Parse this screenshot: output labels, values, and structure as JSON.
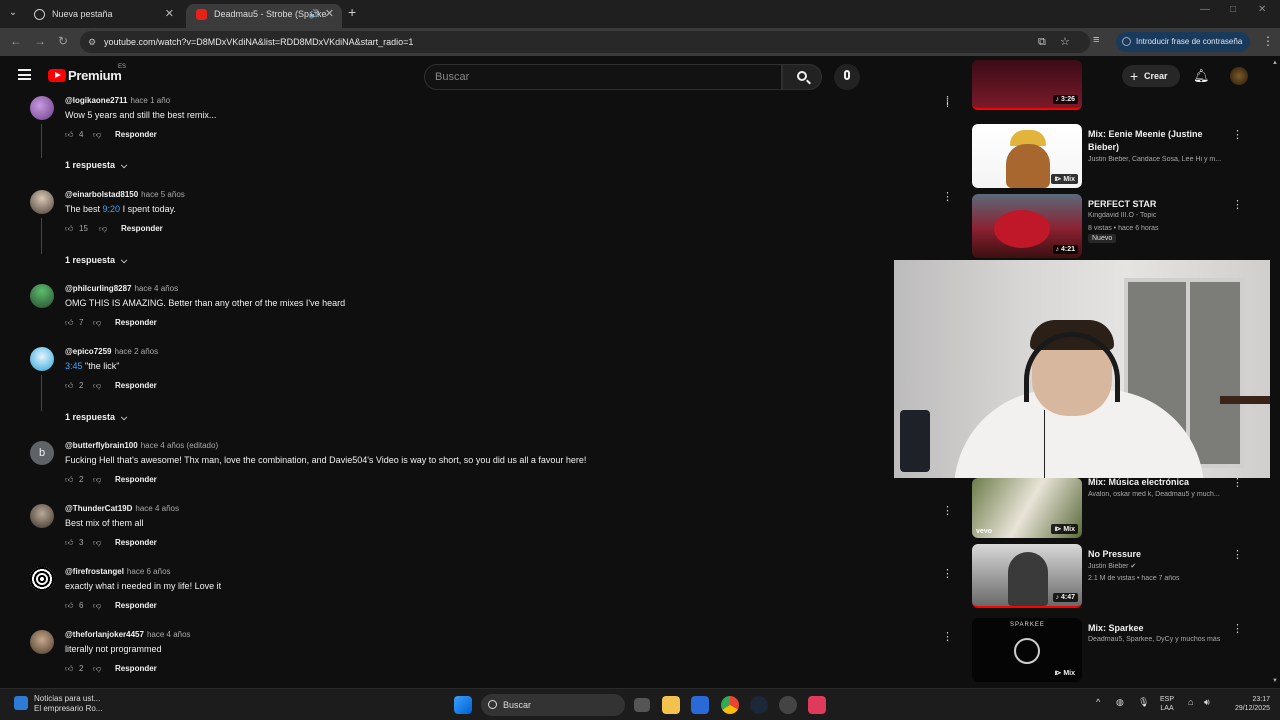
{
  "browser": {
    "tabs": [
      {
        "label": "Nueva pestaña"
      },
      {
        "label": "Deadmau5 - Strobe (Sparke"
      }
    ],
    "url": "youtube.com/watch?v=D8MDxVKdiNA&list=RDD8MDxVKdiNA&start_radio=1",
    "password_prompt": "Introducir frase de contraseña"
  },
  "header": {
    "logo_text": "Premium",
    "region": "ES",
    "search_placeholder": "Buscar",
    "create_label": "Crear"
  },
  "comments": [
    {
      "handle": "@logikaone2711",
      "time": "hace 1 año",
      "text": "Wow 5 years and still the best remix...",
      "likes": "4",
      "reply": "Responder",
      "replies": "1 respuesta"
    },
    {
      "handle": "@einarbolstad8150",
      "time": "hace 5 años",
      "text_pre": "The best ",
      "timestamp": "9:20",
      "text_post": " I spent today.",
      "likes": "15",
      "reply": "Responder",
      "replies": "1 respuesta"
    },
    {
      "handle": "@philcurling8287",
      "time": "hace 4 años",
      "text": "OMG THIS IS AMAZING. Better than any other of the mixes I've heard",
      "likes": "7",
      "reply": "Responder"
    },
    {
      "handle": "@epico7259",
      "time": "hace 2 años",
      "timestamp": "3:45",
      "text_post": " \"the lick\"",
      "likes": "2",
      "reply": "Responder",
      "replies": "1 respuesta"
    },
    {
      "handle": "@butterflybrain100",
      "time": "hace 4 años (editado)",
      "avatar_letter": "b",
      "text": "Fucking Hell that's awesome! Thx man, love the combination, and Davie504's Video is way to short, so you did us all a favour here!",
      "likes": "2",
      "reply": "Responder"
    },
    {
      "handle": "@ThunderCat19D",
      "time": "hace 4 años",
      "text": "Best mix of them all",
      "likes": "3",
      "reply": "Responder"
    },
    {
      "handle": "@firefrostangel",
      "time": "hace 6 años",
      "text": "exactly what i needed in my life! Love it",
      "likes": "6",
      "reply": "Responder"
    },
    {
      "handle": "@theforlanjoker4457",
      "time": "hace 4 años",
      "text": "literally not programmed",
      "likes": "2",
      "reply": "Responder"
    }
  ],
  "related": [
    {
      "duration": "3:26"
    },
    {
      "title": "Mix: Eenie Meenie (Justine Bieber)",
      "meta": "Justin Bieber, Candace Sosa, Lee Hi y m...",
      "badge": "Mix"
    },
    {
      "title": "PERFECT STAR",
      "meta1": "Kingdavid III.O - Topic",
      "meta2": "8 vistas • hace 6 horas",
      "tag": "Nuevo",
      "duration": "4:21"
    },
    {
      "title": "Mix: Música electrónica",
      "meta": "Avalon, oskar med k, Deadmau5 y much...",
      "badge": "Mix",
      "brand": "vevo"
    },
    {
      "title": "No Pressure",
      "meta1": "Justin Bieber ✔",
      "meta2": "2.1 M de vistas • hace 7 años",
      "duration": "4:47"
    },
    {
      "title": "Mix: Sparkee",
      "meta": "Deadmau5, Sparkee, DyCy y muchos más",
      "badge": "Mix",
      "thumb_text": "SPARKEE"
    }
  ],
  "taskbar": {
    "news_line1": "Noticias para ust...",
    "news_line2": "El empresario Ro...",
    "search_label": "Buscar",
    "lang1": "ESP",
    "lang2": "LAA",
    "time": "23:17",
    "date": "29/12/2025"
  }
}
